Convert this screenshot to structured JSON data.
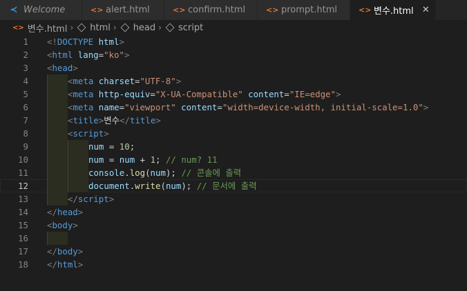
{
  "tabs": [
    {
      "label": "Welcome",
      "icon": "vscode-icon"
    },
    {
      "label": "alert.html",
      "icon": "html-file-icon"
    },
    {
      "label": "confirm.html",
      "icon": "html-file-icon"
    },
    {
      "label": "prompt.html",
      "icon": "html-file-icon"
    },
    {
      "label": "변수.html",
      "icon": "html-file-icon",
      "active": true
    }
  ],
  "close_glyph": "✕",
  "breadcrumbs": [
    "변수.html",
    "html",
    "head",
    "script"
  ],
  "current_line": "12",
  "lines": [
    {
      "n": "1",
      "tokens": [
        [
          "<!",
          "punct"
        ],
        [
          "DOCTYPE",
          "tag"
        ],
        [
          " html",
          "attr"
        ],
        [
          ">",
          "punct"
        ]
      ]
    },
    {
      "n": "2",
      "tokens": [
        [
          "<",
          "punct"
        ],
        [
          "html",
          "tag"
        ],
        [
          " lang",
          "attr"
        ],
        [
          "=",
          "text"
        ],
        [
          "\"ko\"",
          "str"
        ],
        [
          ">",
          "punct"
        ]
      ]
    },
    {
      "n": "3",
      "tokens": [
        [
          "<",
          "punct"
        ],
        [
          "head",
          "tag"
        ],
        [
          ">",
          "punct"
        ]
      ]
    },
    {
      "n": "4",
      "indent": 1,
      "tokens": [
        [
          "<",
          "punct"
        ],
        [
          "meta",
          "tag"
        ],
        [
          " charset",
          "attr"
        ],
        [
          "=",
          "text"
        ],
        [
          "\"UTF-8\"",
          "str"
        ],
        [
          ">",
          "punct"
        ]
      ]
    },
    {
      "n": "5",
      "indent": 1,
      "tokens": [
        [
          "<",
          "punct"
        ],
        [
          "meta",
          "tag"
        ],
        [
          " http-equiv",
          "attr"
        ],
        [
          "=",
          "text"
        ],
        [
          "\"X-UA-Compatible\"",
          "str"
        ],
        [
          " content",
          "attr"
        ],
        [
          "=",
          "text"
        ],
        [
          "\"IE=edge\"",
          "str"
        ],
        [
          ">",
          "punct"
        ]
      ]
    },
    {
      "n": "6",
      "indent": 1,
      "tokens": [
        [
          "<",
          "punct"
        ],
        [
          "meta",
          "tag"
        ],
        [
          " name",
          "attr"
        ],
        [
          "=",
          "text"
        ],
        [
          "\"viewport\"",
          "str"
        ],
        [
          " content",
          "attr"
        ],
        [
          "=",
          "text"
        ],
        [
          "\"width=device-width, initial-scale=1.0\"",
          "str"
        ],
        [
          ">",
          "punct"
        ]
      ]
    },
    {
      "n": "7",
      "indent": 1,
      "tokens": [
        [
          "<",
          "punct"
        ],
        [
          "title",
          "tag"
        ],
        [
          ">",
          "punct"
        ],
        [
          "변수",
          "text"
        ],
        [
          "</",
          "punct"
        ],
        [
          "title",
          "tag"
        ],
        [
          ">",
          "punct"
        ]
      ]
    },
    {
      "n": "8",
      "indent": 1,
      "tokens": [
        [
          "<",
          "punct"
        ],
        [
          "script",
          "tag"
        ],
        [
          ">",
          "punct"
        ]
      ]
    },
    {
      "n": "9",
      "indent": 2,
      "tokens": [
        [
          "num",
          "var"
        ],
        [
          " = ",
          "text"
        ],
        [
          "10",
          "num"
        ],
        [
          ";",
          "text"
        ]
      ]
    },
    {
      "n": "10",
      "indent": 2,
      "tokens": [
        [
          "num",
          "var"
        ],
        [
          " = ",
          "text"
        ],
        [
          "num",
          "var"
        ],
        [
          " + ",
          "text"
        ],
        [
          "1",
          "num"
        ],
        [
          "; ",
          "text"
        ],
        [
          "// num? 11",
          "com"
        ]
      ]
    },
    {
      "n": "11",
      "indent": 2,
      "tokens": [
        [
          "console",
          "var"
        ],
        [
          ".",
          "text"
        ],
        [
          "log",
          "fn"
        ],
        [
          "(",
          "text"
        ],
        [
          "num",
          "var"
        ],
        [
          "); ",
          "text"
        ],
        [
          "// 콘솔에 출력",
          "com"
        ]
      ]
    },
    {
      "n": "12",
      "indent": 2,
      "tokens": [
        [
          "document",
          "var"
        ],
        [
          ".",
          "text"
        ],
        [
          "write",
          "fn"
        ],
        [
          "(",
          "text"
        ],
        [
          "num",
          "var"
        ],
        [
          "); ",
          "text"
        ],
        [
          "// 문서에 출력",
          "com"
        ]
      ]
    },
    {
      "n": "13",
      "indent": 1,
      "tokens": [
        [
          "</",
          "punct"
        ],
        [
          "script",
          "tag"
        ],
        [
          ">",
          "punct"
        ]
      ]
    },
    {
      "n": "14",
      "tokens": [
        [
          "</",
          "punct"
        ],
        [
          "head",
          "tag"
        ],
        [
          ">",
          "punct"
        ]
      ]
    },
    {
      "n": "15",
      "tokens": [
        [
          "<",
          "punct"
        ],
        [
          "body",
          "tag"
        ],
        [
          ">",
          "punct"
        ]
      ]
    },
    {
      "n": "16",
      "indent": 1,
      "tokens": []
    },
    {
      "n": "17",
      "tokens": [
        [
          "</",
          "punct"
        ],
        [
          "body",
          "tag"
        ],
        [
          ">",
          "punct"
        ]
      ]
    },
    {
      "n": "18",
      "tokens": [
        [
          "</",
          "punct"
        ],
        [
          "html",
          "tag"
        ],
        [
          ">",
          "punct"
        ]
      ]
    }
  ]
}
